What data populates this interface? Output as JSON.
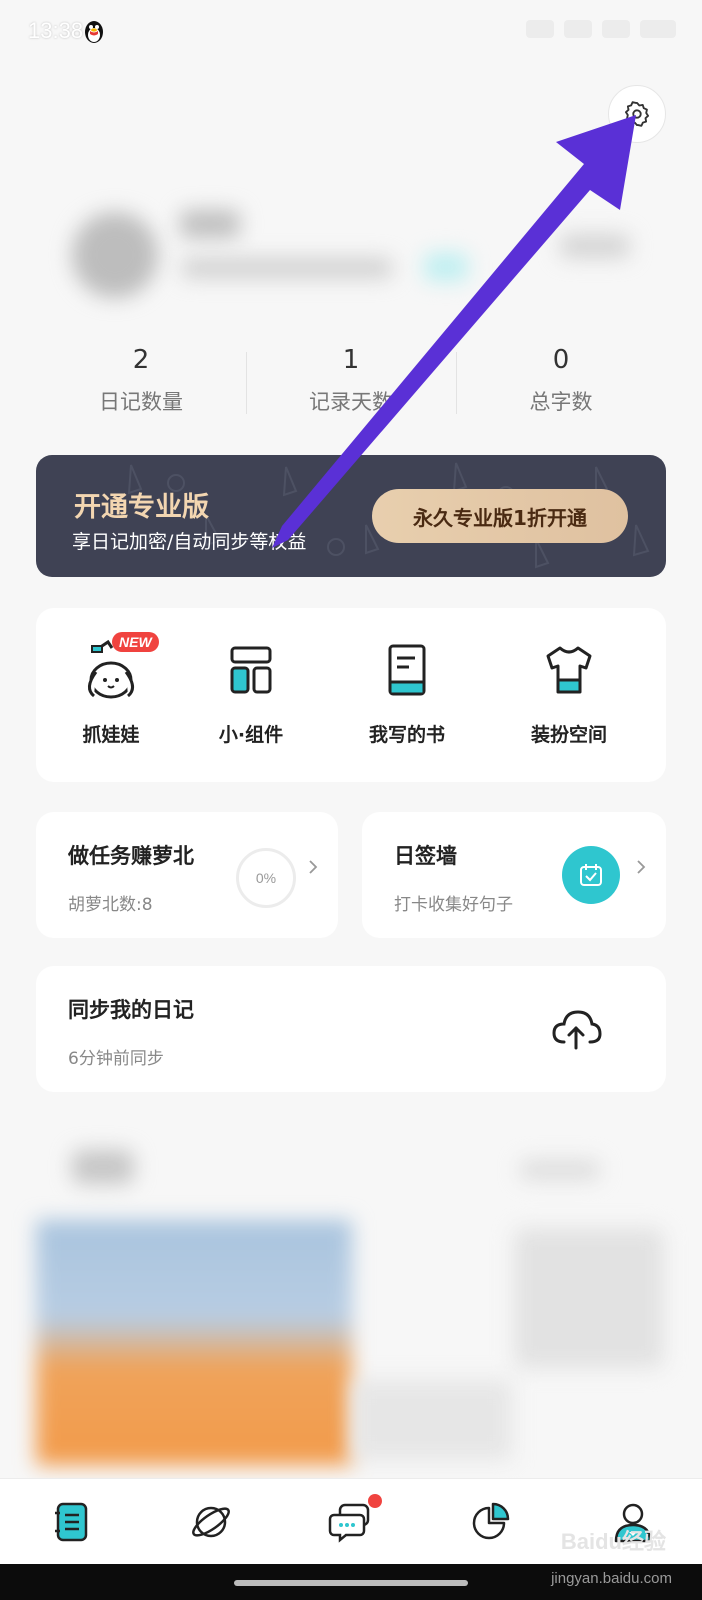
{
  "status_bar": {
    "time": "13:38"
  },
  "stats": [
    {
      "value": "2",
      "label": "日记数量"
    },
    {
      "value": "1",
      "label": "记录天数"
    },
    {
      "value": "0",
      "label": "总字数"
    }
  ],
  "promo": {
    "title": "开通专业版",
    "subtitle": "享日记加密/自动同步等权益",
    "button": "永久专业版1折开通"
  },
  "quick_actions": [
    {
      "label": "抓娃娃",
      "badge": "NEW",
      "icon": "claw-machine-bunny-icon"
    },
    {
      "label": "小·组件",
      "icon": "widget-icon"
    },
    {
      "label": "我写的书",
      "icon": "book-icon"
    },
    {
      "label": "装扮空间",
      "icon": "shirt-icon"
    }
  ],
  "task_card": {
    "title": "做任务赚萝北",
    "subtitle": "胡萝北数:8",
    "progress_label": "0%",
    "progress": 0
  },
  "sign_card": {
    "title": "日签墙",
    "subtitle": "打卡收集好句子",
    "icon": "calendar-check-icon"
  },
  "sync_card": {
    "title": "同步我的日记",
    "subtitle": "6分钟前同步",
    "icon": "cloud-upload-icon"
  },
  "tab_bar": [
    {
      "name": "diary",
      "icon": "notebook-icon"
    },
    {
      "name": "planet",
      "icon": "planet-icon"
    },
    {
      "name": "messages",
      "icon": "chat-icon",
      "has_dot": true
    },
    {
      "name": "stats",
      "icon": "pie-chart-icon"
    },
    {
      "name": "me",
      "icon": "user-icon",
      "active": true
    }
  ],
  "watermark": {
    "brand": "Baidu经验",
    "url": "jingyan.baidu.com"
  },
  "colors": {
    "accent": "#2fc6cf",
    "promo_bg": "#3f4254",
    "promo_gold": "#f3d6b1",
    "arrow": "#5a30d6",
    "badge_red": "#f0433f"
  }
}
